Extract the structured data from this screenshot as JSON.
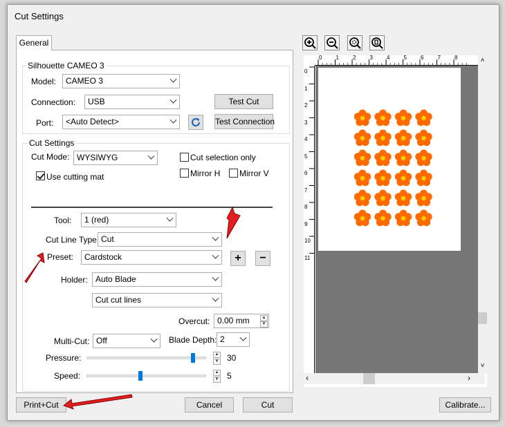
{
  "window": {
    "title": "Cut Settings"
  },
  "tabs": [
    {
      "label": "General"
    }
  ],
  "device_group": {
    "title": "Silhouette CAMEO 3",
    "model_label": "Model:",
    "model_value": "CAMEO 3",
    "connection_label": "Connection:",
    "connection_value": "USB",
    "port_label": "Port:",
    "port_value": "<Auto Detect>",
    "test_cut_label": "Test Cut",
    "test_connection_label": "Test Connection"
  },
  "cut_group": {
    "title": "Cut Settings",
    "cut_mode_label": "Cut Mode:",
    "cut_mode_value": "WYSIWYG",
    "cut_selection_only": "Cut selection only",
    "use_cutting_mat": "Use cutting mat",
    "mirror_h": "Mirror H",
    "mirror_v": "Mirror V",
    "tool_label": "Tool:",
    "tool_value": "1 (red)",
    "cut_line_type_label": "Cut Line Type:",
    "cut_line_type_value": "Cut",
    "preset_label": "Preset:",
    "preset_value": "Cardstock",
    "holder_label": "Holder:",
    "holder_value": "Auto Blade",
    "cut_lines_value": "Cut cut lines",
    "overcut_label": "Overcut:",
    "overcut_value": "0.00 mm",
    "multicut_label": "Multi-Cut:",
    "multicut_value": "Off",
    "blade_depth_label": "Blade Depth:",
    "blade_depth_value": "2",
    "pressure_label": "Pressure:",
    "pressure_value": "30",
    "pressure_fraction": 0.89,
    "speed_label": "Speed:",
    "speed_value": "5",
    "speed_fraction": 0.45,
    "add_symbol": "+",
    "remove_symbol": "−"
  },
  "toolbar": {
    "icons": [
      "zoom-in-icon",
      "zoom-out-icon",
      "zoom-fit-icon",
      "zoom-page-icon"
    ]
  },
  "ruler": {
    "top": [
      "0",
      "1",
      "2",
      "3",
      "4",
      "5",
      "6",
      "7",
      "8"
    ],
    "left": [
      "0",
      "1",
      "2",
      "3",
      "4",
      "5",
      "6",
      "7",
      "8",
      "9",
      "10",
      "11"
    ]
  },
  "footer": {
    "print_cut": "Print+Cut",
    "cancel": "Cancel",
    "cut": "Cut",
    "calibrate": "Calibrate..."
  },
  "colors": {
    "flower_petal": "#ff6a00",
    "flower_center": "#ffd000",
    "annotation_arrow": "#e02020",
    "refresh_icon": "#1f5fbf"
  }
}
